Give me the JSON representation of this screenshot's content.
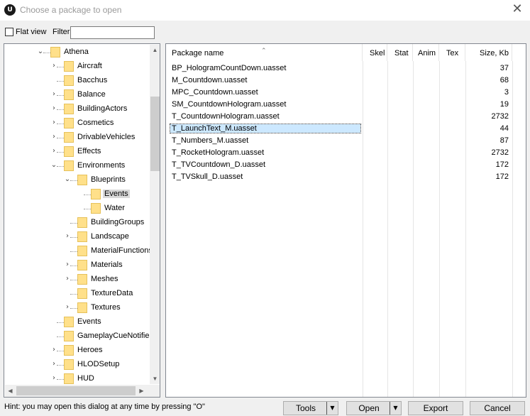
{
  "window": {
    "title": "Choose a package to open",
    "close_glyph": "✕",
    "logo_glyph": "U"
  },
  "toolbar": {
    "flat_view_label": "Flat view",
    "filter_label": "Filter:",
    "filter_value": ""
  },
  "tree": {
    "items": [
      {
        "label": "Athena",
        "depth": 0,
        "toggle": "open",
        "selected": false
      },
      {
        "label": "Aircraft",
        "depth": 1,
        "toggle": "closed",
        "selected": false
      },
      {
        "label": "Bacchus",
        "depth": 1,
        "toggle": "none",
        "selected": false
      },
      {
        "label": "Balance",
        "depth": 1,
        "toggle": "closed",
        "selected": false
      },
      {
        "label": "BuildingActors",
        "depth": 1,
        "toggle": "closed",
        "selected": false
      },
      {
        "label": "Cosmetics",
        "depth": 1,
        "toggle": "closed",
        "selected": false
      },
      {
        "label": "DrivableVehicles",
        "depth": 1,
        "toggle": "closed",
        "selected": false
      },
      {
        "label": "Effects",
        "depth": 1,
        "toggle": "closed",
        "selected": false
      },
      {
        "label": "Environments",
        "depth": 1,
        "toggle": "open",
        "selected": false
      },
      {
        "label": "Blueprints",
        "depth": 2,
        "toggle": "open",
        "selected": false
      },
      {
        "label": "Events",
        "depth": 3,
        "toggle": "none",
        "selected": true
      },
      {
        "label": "Water",
        "depth": 3,
        "toggle": "none",
        "selected": false
      },
      {
        "label": "BuildingGroups",
        "depth": 2,
        "toggle": "none",
        "selected": false
      },
      {
        "label": "Landscape",
        "depth": 2,
        "toggle": "closed",
        "selected": false
      },
      {
        "label": "MaterialFunctions",
        "depth": 2,
        "toggle": "none",
        "selected": false
      },
      {
        "label": "Materials",
        "depth": 2,
        "toggle": "closed",
        "selected": false
      },
      {
        "label": "Meshes",
        "depth": 2,
        "toggle": "closed",
        "selected": false
      },
      {
        "label": "TextureData",
        "depth": 2,
        "toggle": "none",
        "selected": false
      },
      {
        "label": "Textures",
        "depth": 2,
        "toggle": "closed",
        "selected": false
      },
      {
        "label": "Events",
        "depth": 1,
        "toggle": "none",
        "selected": false
      },
      {
        "label": "GameplayCueNotifies",
        "depth": 1,
        "toggle": "none",
        "selected": false
      },
      {
        "label": "Heroes",
        "depth": 1,
        "toggle": "closed",
        "selected": false
      },
      {
        "label": "HLODSetup",
        "depth": 1,
        "toggle": "closed",
        "selected": false
      },
      {
        "label": "HUD",
        "depth": 1,
        "toggle": "closed",
        "selected": false
      }
    ]
  },
  "list": {
    "columns": [
      "Package name",
      "Skel",
      "Stat",
      "Anim",
      "Tex",
      "Size, Kb"
    ],
    "rows": [
      {
        "name": "BP_HologramCountDown.uasset",
        "size": "37",
        "selected": false
      },
      {
        "name": "M_Countdown.uasset",
        "size": "68",
        "selected": false
      },
      {
        "name": "MPC_Countdown.uasset",
        "size": "3",
        "selected": false
      },
      {
        "name": "SM_CountdownHologram.uasset",
        "size": "19",
        "selected": false
      },
      {
        "name": "T_CountdownHologram.uasset",
        "size": "2732",
        "selected": false
      },
      {
        "name": "T_LaunchText_M.uasset",
        "size": "44",
        "selected": true
      },
      {
        "name": "T_Numbers_M.uasset",
        "size": "87",
        "selected": false
      },
      {
        "name": "T_RocketHologram.uasset",
        "size": "2732",
        "selected": false
      },
      {
        "name": "T_TVCountdown_D.uasset",
        "size": "172",
        "selected": false
      },
      {
        "name": "T_TVSkull_D.uasset",
        "size": "172",
        "selected": false
      }
    ]
  },
  "footer": {
    "hint": "Hint: you may open this dialog at any time by pressing \"O\"",
    "tools_label": "Tools",
    "open_label": "Open",
    "export_label": "Export",
    "cancel_label": "Cancel",
    "dropdown_glyph": "▼"
  },
  "colors": {
    "selection": "#cce8ff",
    "folder": "#ffe08a",
    "tree_selected": "#d9d9d9"
  },
  "icons": [
    "unreal-logo-icon",
    "close-icon",
    "folder-icon",
    "expand-arrow-icon",
    "collapse-arrow-icon",
    "sort-up-icon",
    "dropdown-arrow-icon"
  ]
}
